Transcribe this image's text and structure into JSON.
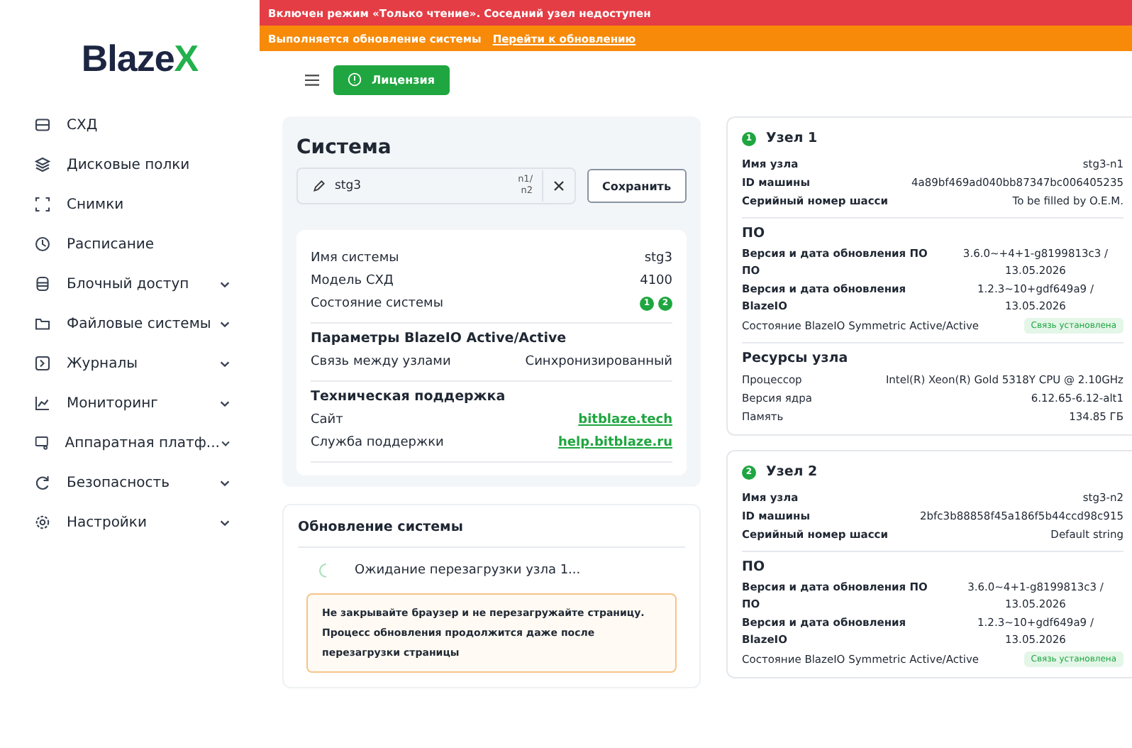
{
  "logo": {
    "text": "Blaze",
    "accent": "X"
  },
  "sidebar": {
    "items": [
      {
        "label": "СХД",
        "expandable": false
      },
      {
        "label": "Дисковые полки",
        "expandable": false
      },
      {
        "label": "Снимки",
        "expandable": false
      },
      {
        "label": "Расписание",
        "expandable": false
      },
      {
        "label": "Блочный доступ",
        "expandable": true
      },
      {
        "label": "Файловые системы",
        "expandable": true
      },
      {
        "label": "Журналы",
        "expandable": true
      },
      {
        "label": "Мониторинг",
        "expandable": true
      },
      {
        "label": "Аппаратная платф...",
        "expandable": true
      },
      {
        "label": "Безопасность",
        "expandable": true
      },
      {
        "label": "Настройки",
        "expandable": true
      }
    ]
  },
  "banners": [
    {
      "kind": "error",
      "text": "Включен режим «Только чтение». Соседний узел недоступен"
    },
    {
      "kind": "warning",
      "text": "Выполняется обновление системы",
      "link": "Перейти к обновлению"
    }
  ],
  "toolbar": {
    "license_button": "Лицензия"
  },
  "system": {
    "title": "Система",
    "name_field": {
      "value": "stg3",
      "nodes": "n1/ n2"
    },
    "save_button": "Сохранить",
    "rows": [
      {
        "label": "Имя системы",
        "value": "stg3"
      },
      {
        "label": "Модель СХД",
        "value": "4100"
      }
    ],
    "state": {
      "label": "Состояние системы",
      "nodes": [
        {
          "label": "1",
          "color": "#1fa640"
        },
        {
          "label": "2",
          "color": "#1fa640"
        }
      ]
    },
    "sections": [
      {
        "title": "Параметры BlazeIO Active/Active",
        "rows": [
          {
            "label": "Связь между узлами",
            "value": "Синхронизированный",
            "kind": "text"
          }
        ]
      },
      {
        "title": "Техническая поддержка",
        "rows": [
          {
            "label": "Сайт",
            "value": "bitblaze.tech",
            "kind": "link"
          },
          {
            "label": "Служба поддержки",
            "value": "help.bitblaze.ru",
            "kind": "link"
          }
        ]
      }
    ]
  },
  "update": {
    "title": "Обновление системы",
    "status": "Ожидание перезагрузки узла 1...",
    "warning": "Не закрывайте браузер и не перезагружайте страницу. Процесс обновления продолжится даже после перезагрузки страницы"
  },
  "nodes": [
    {
      "badge": "1",
      "title": "Узел 1",
      "color": "#1fa640",
      "rows": [
        {
          "label": "Имя узла",
          "value": "stg3-n1"
        },
        {
          "label": "ID машины",
          "value": "4a89bf469ad040bb87347bc006405235"
        },
        {
          "label": "Серийный номер шасси",
          "value": "To be filled by O.E.M."
        }
      ],
      "software": {
        "title": "ПО",
        "rows": [
          {
            "label": "Версия и дата обновления ПО ПО",
            "value": "3.6.0~+4+1-g8199813c3 / 13.05.2026"
          },
          {
            "label": "Версия и дата обновления BlazeIO",
            "value": "1.2.3~10+gdf649a9 / 13.05.2026"
          }
        ],
        "status": {
          "label": "Состояние BlazeIO Symmetric Active/Active",
          "badge": "Связь установлена"
        }
      },
      "resources": {
        "title": "Ресурсы узла",
        "rows": [
          {
            "label": "Процессор",
            "value": "Intel(R) Xeon(R) Gold 5318Y CPU @ 2.10GHz"
          },
          {
            "label": "Версия ядра",
            "value": "6.12.65-6.12-alt1"
          },
          {
            "label": "Память",
            "value": "134.85 ГБ"
          }
        ]
      }
    },
    {
      "badge": "2",
      "title": "Узел 2",
      "color": "#1fa640",
      "rows": [
        {
          "label": "Имя узла",
          "value": "stg3-n2"
        },
        {
          "label": "ID машины",
          "value": "2bfc3b88858f45a186f5b44ccd98c915"
        },
        {
          "label": "Серийный номер шасси",
          "value": "Default string"
        }
      ],
      "software": {
        "title": "ПО",
        "rows": [
          {
            "label": "Версия и дата обновления ПО ПО",
            "value": "3.6.0~4+1-g8199813c3 / 13.05.2026"
          },
          {
            "label": "Версия и дата обновления BlazeIO",
            "value": "1.2.3~10+gdf649a9 / 13.05.2026"
          }
        ],
        "status": {
          "label": "Состояние BlazeIO Symmetric Active/Active",
          "badge": "Связь установлена"
        }
      }
    }
  ]
}
